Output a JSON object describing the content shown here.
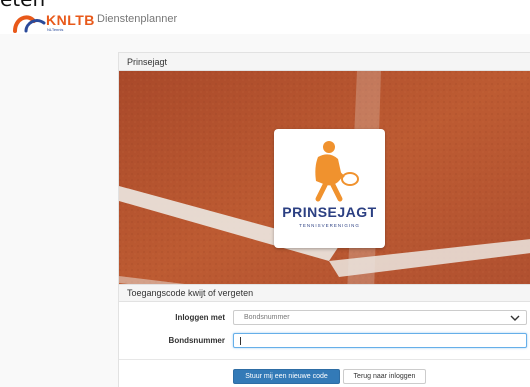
{
  "clipped_heading": "eten",
  "header": {
    "logo_text": "KNLTB",
    "logo_subtext": "NLTennis",
    "app_title": "Dienstenplanner"
  },
  "club_panel": {
    "title": "Prinsejagt",
    "badge_brand": "PRINSEJAGT",
    "badge_sub": "TENNISVERENIGING"
  },
  "form": {
    "title": "Toegangscode kwijt of vergeten",
    "login_with_label": "Inloggen met",
    "login_with_value": "Bondsnummer",
    "member_number_label": "Bondsnummer",
    "member_number_value": "",
    "submit_label": "Stuur mij een nieuwe code",
    "back_label": "Terug naar inloggen"
  },
  "colors": {
    "brand_orange": "#e8591a",
    "brand_blue": "#2b3f82",
    "primary_button": "#337ab7",
    "clay": "#b5552d"
  }
}
